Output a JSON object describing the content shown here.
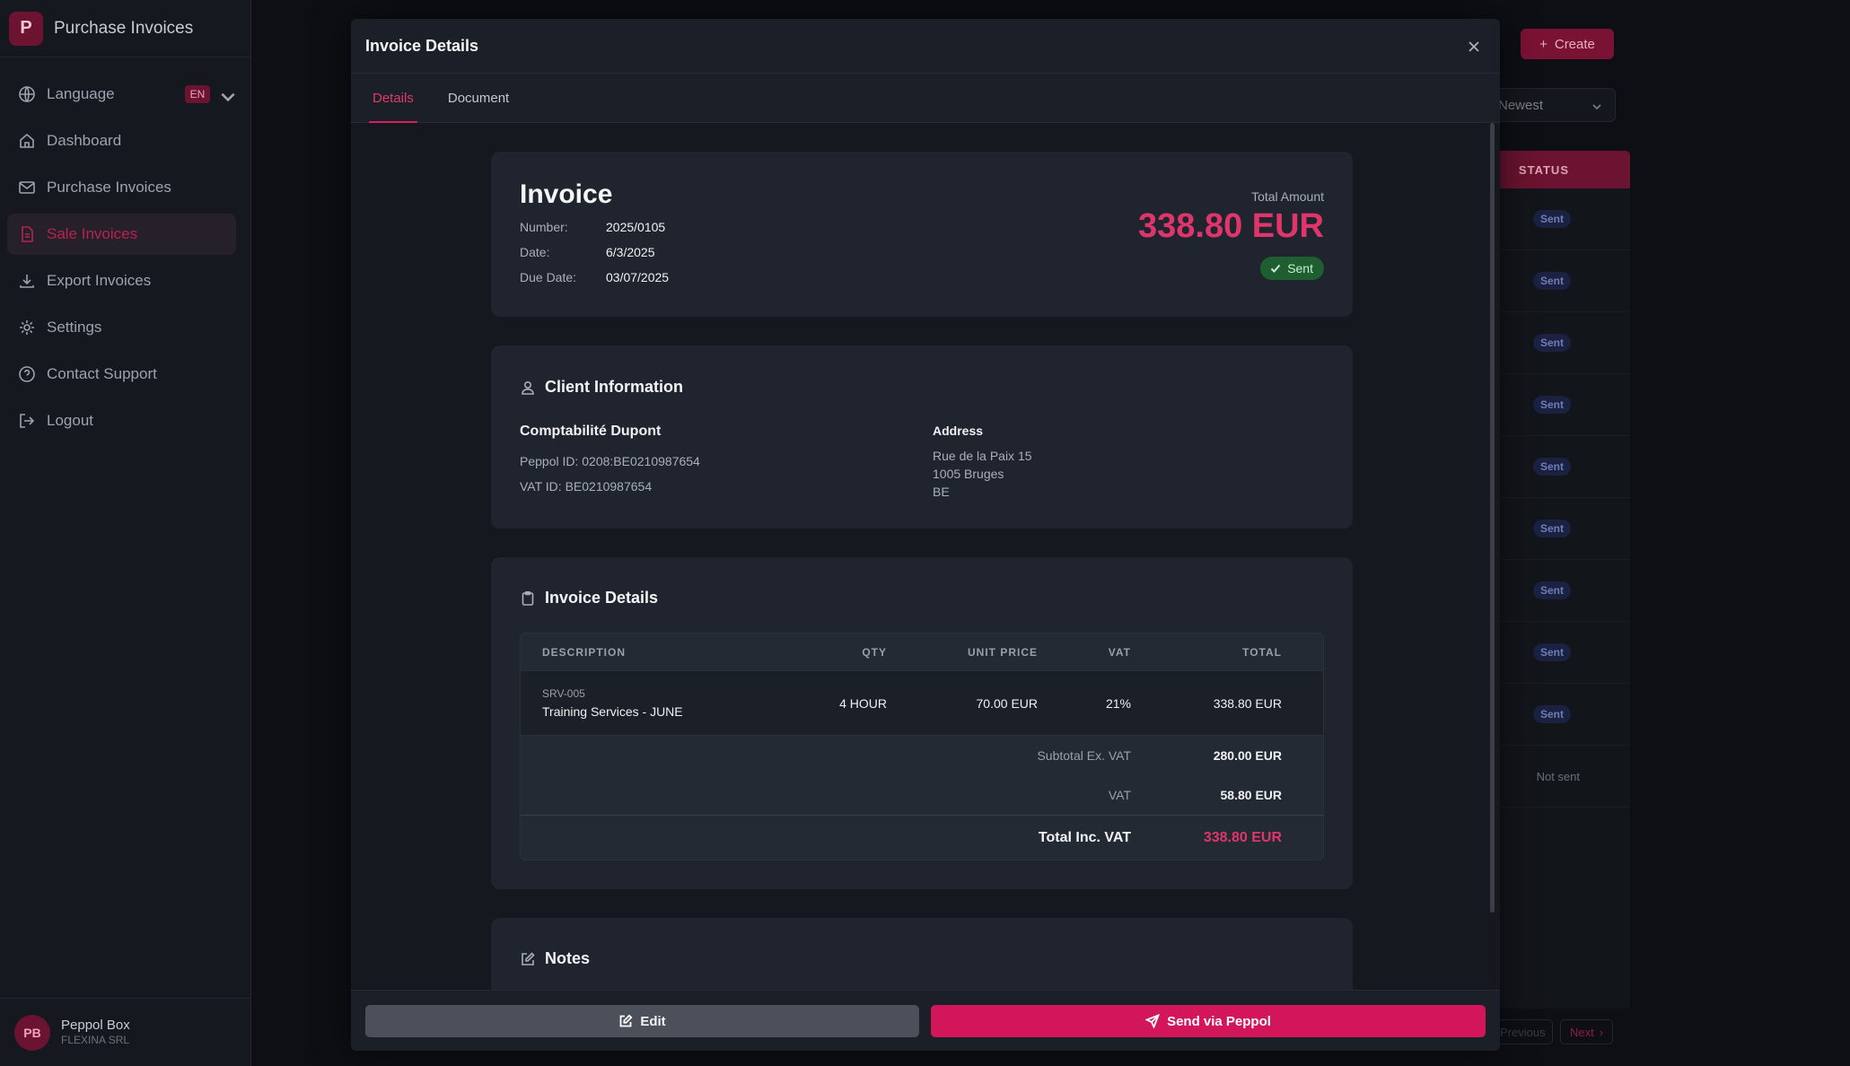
{
  "app": {
    "logo_letter": "P",
    "title": "Purchase Invoices"
  },
  "sidebar": {
    "language": {
      "label": "Language",
      "code": "EN"
    },
    "items": [
      {
        "label": "Dashboard",
        "icon": "home-icon"
      },
      {
        "label": "Purchase Invoices",
        "icon": "mail-icon"
      },
      {
        "label": "Sale Invoices",
        "icon": "file-icon",
        "active": true
      },
      {
        "label": "Export Invoices",
        "icon": "download-icon"
      },
      {
        "label": "Settings",
        "icon": "gear-icon"
      },
      {
        "label": "Contact Support",
        "icon": "help-icon"
      },
      {
        "label": "Logout",
        "icon": "logout-icon"
      }
    ],
    "profile": {
      "initials": "PB",
      "name": "Peppol Box",
      "org": "FLEXINA SRL"
    }
  },
  "background": {
    "create_label": "Create",
    "sort_value": "Newest",
    "status_header": "STATUS",
    "statuses": [
      "Sent",
      "Sent",
      "Sent",
      "Sent",
      "Sent",
      "Sent",
      "Sent",
      "Sent",
      "Sent",
      "Not sent"
    ],
    "prev_label": "Previous",
    "next_label": "Next"
  },
  "modal": {
    "title": "Invoice Details",
    "tabs": [
      "Details",
      "Document"
    ],
    "invoice": {
      "heading": "Invoice",
      "number_label": "Number:",
      "number": "2025/0105",
      "date_label": "Date:",
      "date": "6/3/2025",
      "due_label": "Due Date:",
      "due": "03/07/2025",
      "total_label": "Total Amount",
      "total": "338.80 EUR",
      "status": "Sent"
    },
    "client": {
      "section_title": "Client Information",
      "name": "Comptabilité Dupont",
      "peppol": "Peppol ID: 0208:BE0210987654",
      "vat": "VAT ID: BE0210987654",
      "address_label": "Address",
      "address_lines": [
        "Rue de la Paix 15",
        "1005 Bruges",
        "BE"
      ]
    },
    "details": {
      "section_title": "Invoice Details",
      "headers": {
        "description": "DESCRIPTION",
        "qty": "QTY",
        "unit_price": "UNIT PRICE",
        "vat": "VAT",
        "total": "TOTAL"
      },
      "rows": [
        {
          "sku": "SRV-005",
          "description": "Training Services - JUNE",
          "qty": "4 HOUR",
          "unit_price": "70.00 EUR",
          "vat": "21%",
          "total": "338.80 EUR"
        }
      ],
      "subtotal_label": "Subtotal Ex. VAT",
      "subtotal": "280.00 EUR",
      "vat_label": "VAT",
      "vat_amount": "58.80 EUR",
      "grand_label": "Total Inc. VAT",
      "grand_total": "338.80 EUR"
    },
    "notes": {
      "section_title": "Notes"
    },
    "footer": {
      "edit_label": "Edit",
      "send_label": "Send via Peppol"
    }
  },
  "colors": {
    "accent": "#d3155a",
    "success": "#1f5e30",
    "surface": "#1f242e"
  }
}
